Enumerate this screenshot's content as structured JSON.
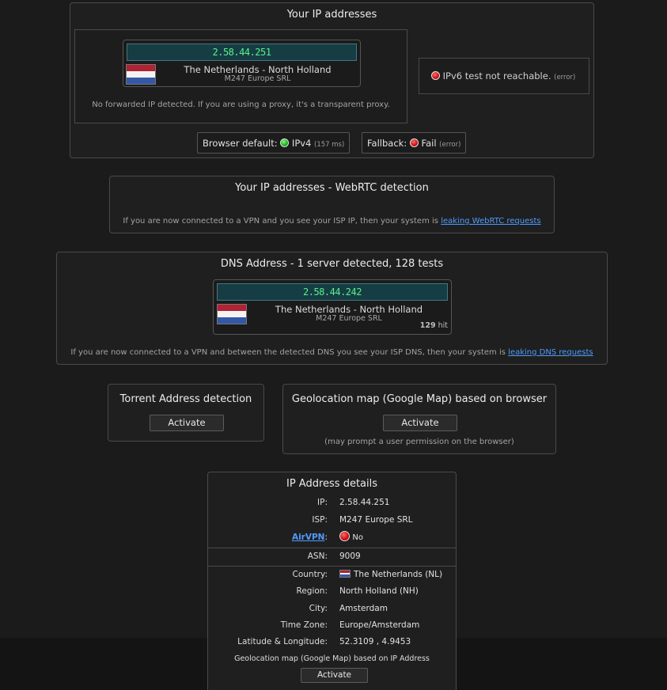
{
  "ip_panel": {
    "title": "Your IP addresses",
    "ip": "2.58.44.251",
    "country": "The Netherlands - North Holland",
    "isp": "M247 Europe SRL",
    "no_forward_note": "No forwarded IP detected. If you are using a proxy, it's a transparent proxy.",
    "ipv6_status": "IPv6 test not reachable.",
    "ipv6_note": "(error)",
    "browser_default_label": "Browser default:",
    "browser_default_value": "IPv4",
    "browser_default_ms": "(157 ms)",
    "fallback_label": "Fallback:",
    "fallback_value": "Fail",
    "fallback_note": "(error)"
  },
  "webrtc_panel": {
    "title": "Your IP addresses - WebRTC detection",
    "note": "If you are now connected to a VPN and you see your ISP IP, then your system is",
    "link": "leaking WebRTC requests"
  },
  "dns_panel": {
    "title": "DNS Address - 1 server detected, 128 tests",
    "ip": "2.58.44.242",
    "country": "The Netherlands - North Holland",
    "isp": "M247 Europe SRL",
    "hit_count": "129",
    "hit_label": "hit",
    "note": "If you are now connected to a VPN and between the detected DNS you see your ISP DNS, then your system is",
    "link": "leaking DNS requests"
  },
  "torrent_panel": {
    "title": "Torrent Address detection",
    "button": "Activate"
  },
  "geo_panel": {
    "title": "Geolocation map (Google Map) based on browser",
    "button": "Activate",
    "note": "(may prompt a user permission on the browser)"
  },
  "details_panel": {
    "title": "IP Address details",
    "ip_label": "IP:",
    "ip_value": "2.58.44.251",
    "isp_label": "ISP:",
    "isp_value": "M247 Europe SRL",
    "airvpn_link": "AirVPN",
    "airvpn_colon": ":",
    "airvpn_value": "No",
    "asn_label": "ASN:",
    "asn_value": "9009",
    "country_label": "Country:",
    "country_value": "The Netherlands (NL)",
    "region_label": "Region:",
    "region_value": "North Holland (NH)",
    "city_label": "City:",
    "city_value": "Amsterdam",
    "tz_label": "Time Zone:",
    "tz_value": "Europe/Amsterdam",
    "latlng_label": "Latitude & Longitude:",
    "latlng_value": "52.3109 , 4.9453",
    "geo_caption": "Geolocation map (Google Map) based on IP Address",
    "button": "Activate"
  },
  "colors": {
    "background": "#1b1b1c",
    "ip_text": "#5bf08a",
    "link": "#4e9cff",
    "status_red": "#c00000",
    "status_green": "#0a9d0a"
  },
  "icons": [
    "status-dot-red",
    "status-dot-green",
    "netherlands-flag"
  ]
}
